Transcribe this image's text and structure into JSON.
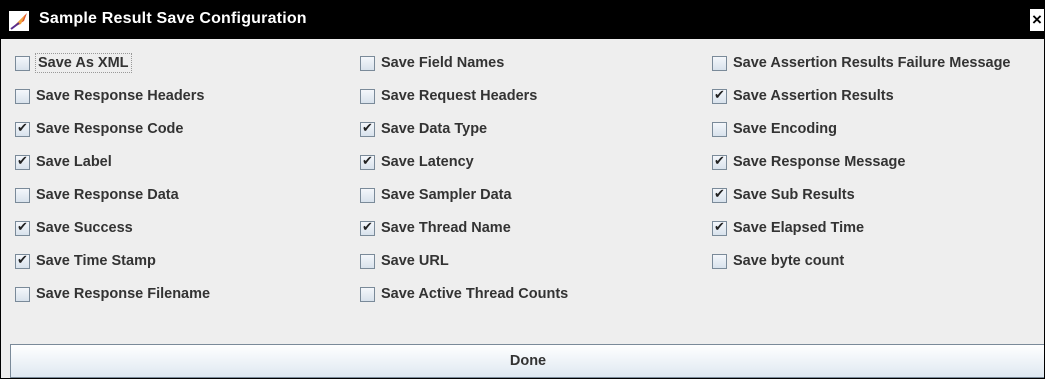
{
  "window": {
    "title": "Sample Result Save Configuration",
    "icon": "jmeter-feather-icon",
    "close_label": "×"
  },
  "columns": [
    [
      {
        "label": "Save As XML",
        "checked": false
      },
      {
        "label": "Save Response Headers",
        "checked": false
      },
      {
        "label": "Save Response Code",
        "checked": true
      },
      {
        "label": "Save Label",
        "checked": true
      },
      {
        "label": "Save Response Data",
        "checked": false
      },
      {
        "label": "Save Success",
        "checked": true
      },
      {
        "label": "Save Time Stamp",
        "checked": true
      },
      {
        "label": "Save Response Filename",
        "checked": false
      }
    ],
    [
      {
        "label": "Save Field Names",
        "checked": false
      },
      {
        "label": "Save Request Headers",
        "checked": false
      },
      {
        "label": "Save Data Type",
        "checked": true
      },
      {
        "label": "Save Latency",
        "checked": true
      },
      {
        "label": "Save Sampler Data",
        "checked": false
      },
      {
        "label": "Save Thread Name",
        "checked": true
      },
      {
        "label": "Save URL",
        "checked": false
      },
      {
        "label": "Save Active Thread Counts",
        "checked": false
      }
    ],
    [
      {
        "label": "Save Assertion Results Failure Message",
        "checked": false
      },
      {
        "label": "Save Assertion Results",
        "checked": true
      },
      {
        "label": "Save Encoding",
        "checked": false
      },
      {
        "label": "Save Response Message",
        "checked": true
      },
      {
        "label": "Save Sub Results",
        "checked": true
      },
      {
        "label": "Save Elapsed Time",
        "checked": true
      },
      {
        "label": "Save byte count",
        "checked": false
      }
    ]
  ],
  "done_label": "Done"
}
